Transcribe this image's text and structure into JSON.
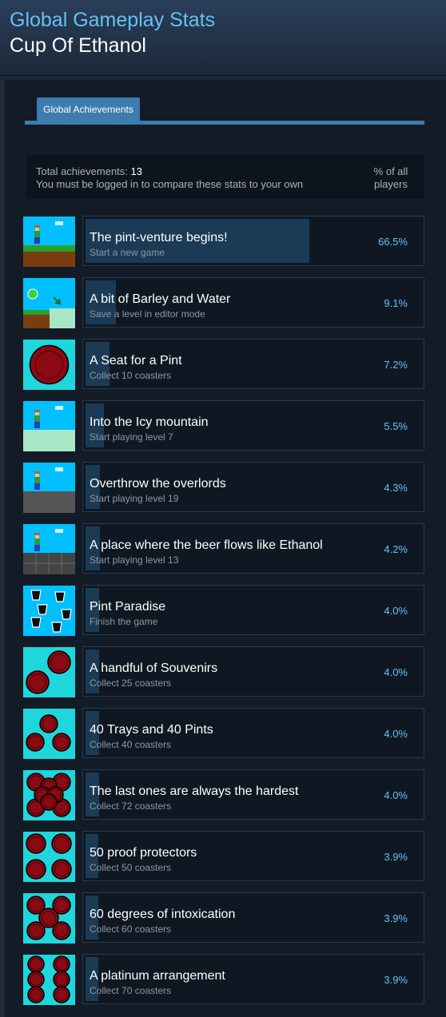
{
  "header": {
    "title": "Global Gameplay Stats",
    "game": "Cup Of Ethanol"
  },
  "tabs": [
    {
      "label": "Global Achievements"
    }
  ],
  "summary": {
    "total_label": "Total achievements:",
    "total_value": "13",
    "note": "You must be logged in to compare these stats to your own",
    "pct_header": "% of all players"
  },
  "colors": {
    "accent": "#66c0f4",
    "tab": "#3c7cae",
    "coaster": "#8b0a14",
    "icon_cyan": "#1fd6dc",
    "icon_sky": "#00c0ff"
  },
  "achievements": [
    {
      "title": "The pint-venture begins!",
      "desc": "Start a new game",
      "pct": "66.5%",
      "percent": 66.5,
      "icon": "grass-level-icon"
    },
    {
      "title": "A bit of Barley and Water",
      "desc": "Save a level in editor mode",
      "pct": "9.1%",
      "percent": 9.1,
      "icon": "editor-level-icon"
    },
    {
      "title": "A Seat for a Pint",
      "desc": "Collect 10 coasters",
      "pct": "7.2%",
      "percent": 7.2,
      "icon": "single-coaster-icon"
    },
    {
      "title": "Into the Icy mountain",
      "desc": "Start playing level 7",
      "pct": "5.5%",
      "percent": 5.5,
      "icon": "ice-level-icon"
    },
    {
      "title": "Overthrow the overlords",
      "desc": "Start playing level 19",
      "pct": "4.3%",
      "percent": 4.3,
      "icon": "stone-level-icon"
    },
    {
      "title": "A place where the beer flows like Ethanol",
      "desc": "Start playing level 13",
      "pct": "4.2%",
      "percent": 4.2,
      "icon": "brick-level-icon"
    },
    {
      "title": "Pint Paradise",
      "desc": "Finish the game",
      "pct": "4.0%",
      "percent": 4.0,
      "icon": "pint-glasses-icon"
    },
    {
      "title": "A handful of Souvenirs",
      "desc": "Collect 25 coasters",
      "pct": "4.0%",
      "percent": 4.0,
      "icon": "two-coasters-icon"
    },
    {
      "title": "40 Trays and 40 Pints",
      "desc": "Collect 40 coasters",
      "pct": "4.0%",
      "percent": 4.0,
      "icon": "three-coasters-icon"
    },
    {
      "title": "The last ones are always the hardest",
      "desc": "Collect 72 coasters",
      "pct": "4.0%",
      "percent": 4.0,
      "icon": "coaster-pile-icon"
    },
    {
      "title": "50 proof protectors",
      "desc": "Collect 50 coasters",
      "pct": "3.9%",
      "percent": 3.9,
      "icon": "four-coasters-icon"
    },
    {
      "title": "60 degrees of intoxication",
      "desc": "Collect 60 coasters",
      "pct": "3.9%",
      "percent": 3.9,
      "icon": "five-coasters-icon"
    },
    {
      "title": "A platinum arrangement",
      "desc": "Collect 70 coasters",
      "pct": "3.9%",
      "percent": 3.9,
      "icon": "six-coasters-icon"
    }
  ]
}
